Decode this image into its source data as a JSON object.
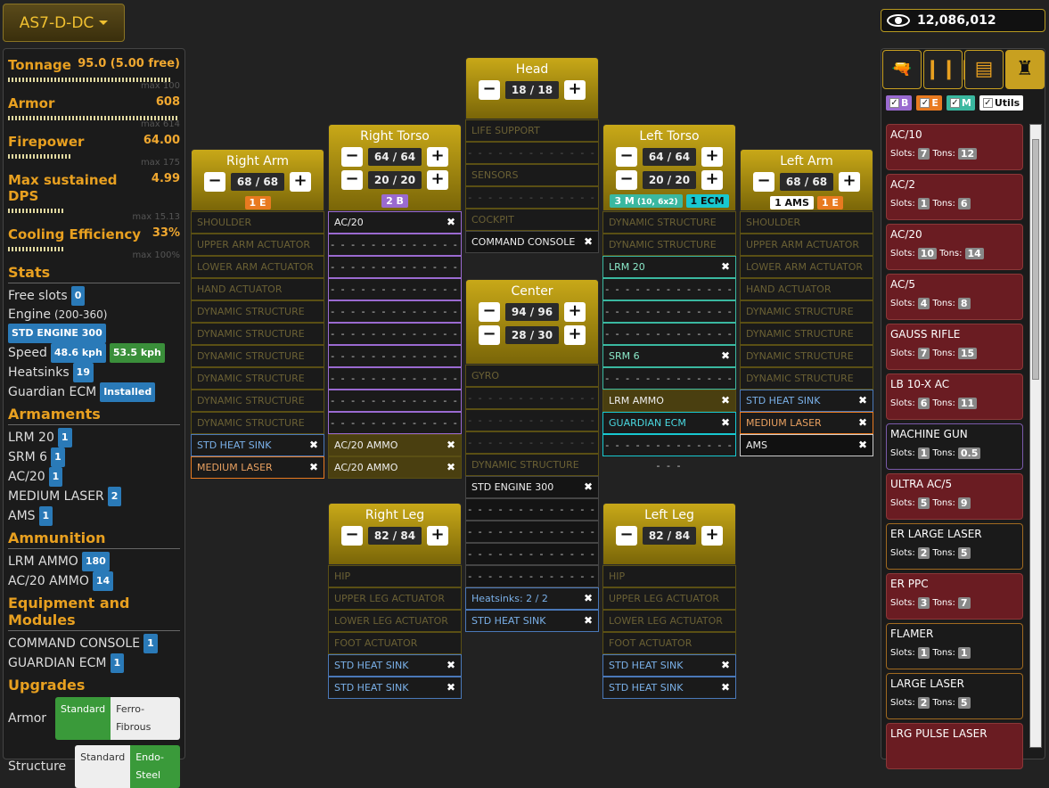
{
  "mech_name": "AS7-D-DC",
  "cbills": "12,086,012",
  "stats": [
    {
      "label": "Tonnage",
      "value": "95.0 (5.00 free)",
      "max": "max 100",
      "fill": 0.95
    },
    {
      "label": "Armor",
      "value": "608",
      "max": "max 614",
      "fill": 0.99
    },
    {
      "label": "Firepower",
      "value": "64.00",
      "max": "max 175",
      "fill": 0.37
    },
    {
      "label": "Max sustained DPS",
      "value": "4.99",
      "max": "max 15.13",
      "fill": 0.33
    },
    {
      "label": "Cooling Efficiency",
      "value": "33%",
      "max": "max 100%",
      "fill": 0.33
    }
  ],
  "stats_section": {
    "title": "Stats",
    "free_slots_label": "Free slots",
    "free_slots": "0",
    "engine_label": "Engine",
    "engine_range": "(200-360)",
    "engine_badge": "STD ENGINE 300",
    "speed_label": "Speed",
    "speed1": "48.6 kph",
    "speed2": "53.5 kph",
    "heatsinks_label": "Heatsinks",
    "heatsinks": "19",
    "ecm_label": "Guardian ECM",
    "ecm_value": "Installed"
  },
  "armaments": {
    "title": "Armaments",
    "items": [
      {
        "name": "LRM 20",
        "count": "1"
      },
      {
        "name": "SRM 6",
        "count": "1"
      },
      {
        "name": "AC/20",
        "count": "1"
      },
      {
        "name": "MEDIUM LASER",
        "count": "2"
      },
      {
        "name": "AMS",
        "count": "1"
      }
    ]
  },
  "ammunition": {
    "title": "Ammunition",
    "items": [
      {
        "name": "LRM AMMO",
        "count": "180"
      },
      {
        "name": "AC/20 AMMO",
        "count": "14"
      }
    ]
  },
  "equipment": {
    "title": "Equipment and Modules",
    "items": [
      {
        "name": "COMMAND CONSOLE",
        "count": "1"
      },
      {
        "name": "GUARDIAN ECM",
        "count": "1"
      }
    ]
  },
  "upgrades": {
    "title": "Upgrades",
    "armor_label": "Armor",
    "structure_label": "Structure",
    "standard": "Standard",
    "ferro": "Ferro-Fibrous",
    "endo": "Endo-Steel"
  },
  "parts": {
    "right_arm": {
      "name": "Right Arm",
      "armor": "68 / 68",
      "tags": [
        {
          "t": "1 E",
          "c": "e"
        }
      ],
      "slots": [
        [
          "SHOULDER",
          "fixed"
        ],
        [
          "UPPER ARM ACTUATOR",
          "fixed"
        ],
        [
          "LOWER ARM ACTUATOR",
          "fixed"
        ],
        [
          "HAND ACTUATOR",
          "fixed"
        ],
        [
          "DYNAMIC STRUCTURE",
          "fixed"
        ],
        [
          "DYNAMIC STRUCTURE",
          "fixed"
        ],
        [
          "DYNAMIC STRUCTURE",
          "fixed"
        ],
        [
          "DYNAMIC STRUCTURE",
          "fixed"
        ],
        [
          "DYNAMIC STRUCTURE",
          "fixed"
        ],
        [
          "DYNAMIC STRUCTURE",
          "fixed"
        ],
        [
          "STD HEAT SINK",
          "hs"
        ],
        [
          "MEDIUM LASER",
          "en"
        ]
      ]
    },
    "right_torso": {
      "name": "Right Torso",
      "armor": "64 / 64",
      "armor2": "20 / 20",
      "tags": [
        {
          "t": "2 B",
          "c": "b"
        }
      ],
      "slots": [
        [
          "AC/20",
          "bal"
        ],
        [
          "",
          "bal"
        ],
        [
          "",
          "bal"
        ],
        [
          "",
          "bal"
        ],
        [
          "",
          "bal"
        ],
        [
          "",
          "bal"
        ],
        [
          "",
          "bal"
        ],
        [
          "",
          "bal"
        ],
        [
          "",
          "bal"
        ],
        [
          "",
          "bal"
        ],
        [
          "AC/20 AMMO",
          "ammo"
        ],
        [
          "AC/20 AMMO",
          "ammo"
        ]
      ]
    },
    "head": {
      "name": "Head",
      "armor": "18 / 18",
      "slots": [
        [
          "LIFE SUPPORT",
          "fixed"
        ],
        [
          "",
          "fixedempty"
        ],
        [
          "SENSORS",
          "fixed"
        ],
        [
          "",
          "fixedempty"
        ],
        [
          "COCKPIT",
          "fixed"
        ],
        [
          "COMMAND CONSOLE",
          "item"
        ]
      ]
    },
    "center": {
      "name": "Center",
      "armor": "94 / 96",
      "armor2": "28 / 30",
      "slots": [
        [
          "GYRO",
          "fixed"
        ],
        [
          "",
          "fixedempty"
        ],
        [
          "",
          "fixedempty"
        ],
        [
          "",
          "fixedempty"
        ],
        [
          "DYNAMIC STRUCTURE",
          "fixed"
        ],
        [
          "STD ENGINE 300",
          "item"
        ],
        [
          "",
          "plain"
        ],
        [
          "",
          "plain"
        ],
        [
          "",
          "plain"
        ],
        [
          "",
          "plain"
        ],
        [
          "Heatsinks: 2 / 2",
          "hs"
        ],
        [
          "STD HEAT SINK",
          "hs"
        ]
      ]
    },
    "left_torso": {
      "name": "Left Torso",
      "armor": "64 / 64",
      "armor2": "20 / 20",
      "tags": [
        {
          "t": "3 M",
          "c": "m",
          "sub": "(10, 6x2)"
        },
        {
          "t": "1 ECM",
          "c": "ecm"
        }
      ],
      "slots": [
        [
          "DYNAMIC STRUCTURE",
          "fixed"
        ],
        [
          "DYNAMIC STRUCTURE",
          "fixed"
        ],
        [
          "LRM 20",
          "msl"
        ],
        [
          "",
          "msl"
        ],
        [
          "",
          "msl"
        ],
        [
          "",
          "msl"
        ],
        [
          "SRM 6",
          "msl"
        ],
        [
          "",
          "msl"
        ],
        [
          "LRM AMMO",
          "ammo"
        ],
        [
          "GUARDIAN ECM",
          "ecmslot"
        ],
        [
          "",
          "ecmslot"
        ]
      ]
    },
    "left_arm": {
      "name": "Left Arm",
      "armor": "68 / 68",
      "tags": [
        {
          "t": "1 AMS",
          "c": "ams"
        },
        {
          "t": "1 E",
          "c": "e"
        }
      ],
      "slots": [
        [
          "SHOULDER",
          "fixed"
        ],
        [
          "UPPER ARM ACTUATOR",
          "fixed"
        ],
        [
          "LOWER ARM ACTUATOR",
          "fixed"
        ],
        [
          "HAND ACTUATOR",
          "fixed"
        ],
        [
          "DYNAMIC STRUCTURE",
          "fixed"
        ],
        [
          "DYNAMIC STRUCTURE",
          "fixed"
        ],
        [
          "DYNAMIC STRUCTURE",
          "fixed"
        ],
        [
          "DYNAMIC STRUCTURE",
          "fixed"
        ],
        [
          "STD HEAT SINK",
          "hs"
        ],
        [
          "MEDIUM LASER",
          "en"
        ],
        [
          "AMS",
          "amsslot"
        ]
      ]
    },
    "right_leg": {
      "name": "Right Leg",
      "armor": "82 / 84",
      "slots": [
        [
          "HIP",
          "fixed"
        ],
        [
          "UPPER LEG ACTUATOR",
          "fixed"
        ],
        [
          "LOWER LEG ACTUATOR",
          "fixed"
        ],
        [
          "FOOT ACTUATOR",
          "fixed"
        ],
        [
          "STD HEAT SINK",
          "hs"
        ],
        [
          "STD HEAT SINK",
          "hs"
        ]
      ]
    },
    "left_leg": {
      "name": "Left Leg",
      "armor": "82 / 84",
      "slots": [
        [
          "HIP",
          "fixed"
        ],
        [
          "UPPER LEG ACTUATOR",
          "fixed"
        ],
        [
          "LOWER LEG ACTUATOR",
          "fixed"
        ],
        [
          "FOOT ACTUATOR",
          "fixed"
        ],
        [
          "STD HEAT SINK",
          "hs"
        ],
        [
          "STD HEAT SINK",
          "hs"
        ]
      ]
    }
  },
  "filters": [
    {
      "label": "B",
      "color": "#9a6ad0"
    },
    {
      "label": "E",
      "color": "#e87a20"
    },
    {
      "label": "M",
      "color": "#3ab8a0"
    },
    {
      "label": "Utils",
      "color": "#fff"
    }
  ],
  "slots_label": "Slots:",
  "tons_label": "Tons:",
  "weapons": [
    {
      "name": "AC/10",
      "slots": "7",
      "tons": "12",
      "kind": "bal"
    },
    {
      "name": "AC/2",
      "slots": "1",
      "tons": "6",
      "kind": "bal"
    },
    {
      "name": "AC/20",
      "slots": "10",
      "tons": "14",
      "kind": "bal"
    },
    {
      "name": "AC/5",
      "slots": "4",
      "tons": "8",
      "kind": "bal"
    },
    {
      "name": "GAUSS RIFLE",
      "slots": "7",
      "tons": "15",
      "kind": "bal"
    },
    {
      "name": "LB 10-X AC",
      "slots": "6",
      "tons": "11",
      "kind": "bal"
    },
    {
      "name": "MACHINE GUN",
      "slots": "1",
      "tons": "0.5",
      "kind": "msl"
    },
    {
      "name": "ULTRA AC/5",
      "slots": "5",
      "tons": "9",
      "kind": "bal"
    },
    {
      "name": "ER LARGE LASER",
      "slots": "2",
      "tons": "5",
      "kind": "en"
    },
    {
      "name": "ER PPC",
      "slots": "3",
      "tons": "7",
      "kind": "bal"
    },
    {
      "name": "FLAMER",
      "slots": "1",
      "tons": "1",
      "kind": "en"
    },
    {
      "name": "LARGE LASER",
      "slots": "2",
      "tons": "5",
      "kind": "en"
    },
    {
      "name": "LRG PULSE LASER",
      "slots": "",
      "tons": "",
      "kind": "bal"
    }
  ]
}
